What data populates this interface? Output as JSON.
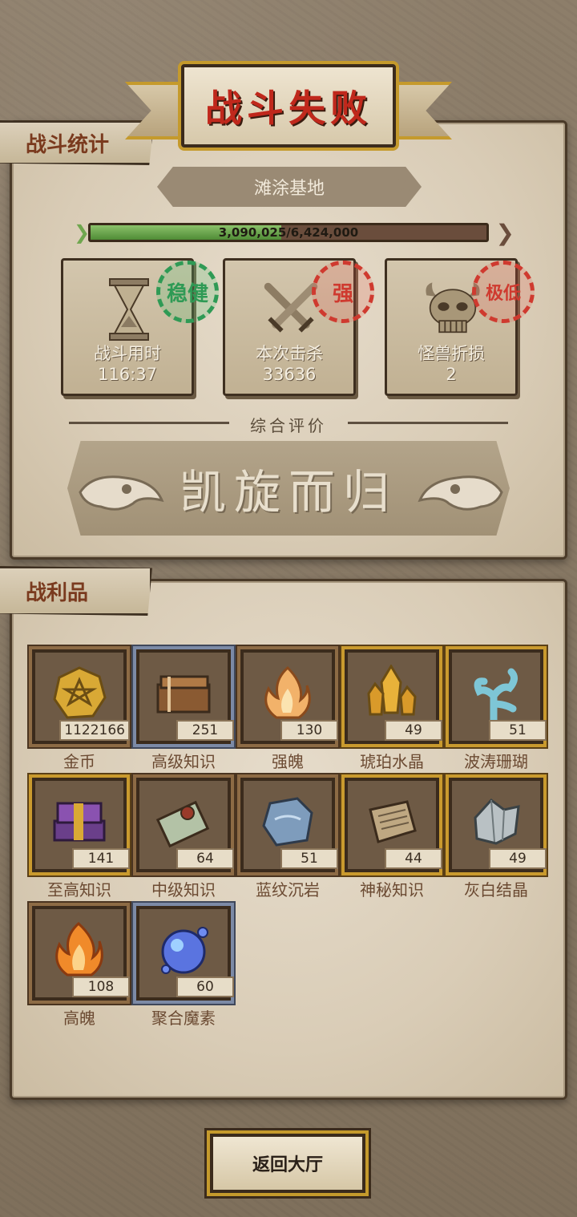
{
  "header": {
    "title": "战斗失败"
  },
  "sections": {
    "stats_label": "战斗统计",
    "loot_label": "战利品"
  },
  "battle": {
    "location": "滩涂基地",
    "progress": {
      "current": 3090025,
      "total": 6424000,
      "text": "3,090,025/6,424,000",
      "fraction": 0.481
    }
  },
  "stats": [
    {
      "label": "战斗用时",
      "value": "116:37",
      "seal": "稳健",
      "seal_color": "#2f9a55",
      "icon": "hourglass-icon"
    },
    {
      "label": "本次击杀",
      "value": "33636",
      "seal": "强",
      "seal_color": "#cf3a2f",
      "icon": "crossed-swords-icon"
    },
    {
      "label": "怪兽折损",
      "value": "2",
      "seal": "极低",
      "seal_color": "#cf3a2f",
      "icon": "monster-skull-icon"
    }
  ],
  "evaluation": {
    "label": "综合评价",
    "result": "凯旋而归"
  },
  "loot": [
    {
      "name": "金币",
      "count": "1122166",
      "tier": "brown",
      "icon": "gold-coin-icon"
    },
    {
      "name": "高级知识",
      "count": "251",
      "tier": "blue",
      "icon": "tome-icon"
    },
    {
      "name": "强魄",
      "count": "130",
      "tier": "brown",
      "icon": "flame-icon"
    },
    {
      "name": "琥珀水晶",
      "count": "49",
      "tier": "gold",
      "icon": "amber-crystal-icon"
    },
    {
      "name": "波涛珊瑚",
      "count": "51",
      "tier": "gold",
      "icon": "coral-icon"
    },
    {
      "name": "至高知识",
      "count": "141",
      "tier": "gold",
      "icon": "purple-book-icon"
    },
    {
      "name": "中级知识",
      "count": "64",
      "tier": "brown",
      "icon": "scroll-icon"
    },
    {
      "name": "蓝纹沉岩",
      "count": "51",
      "tier": "brown",
      "icon": "blue-rock-icon"
    },
    {
      "name": "神秘知识",
      "count": "44",
      "tier": "gold",
      "icon": "stone-tablet-icon"
    },
    {
      "name": "灰白结晶",
      "count": "49",
      "tier": "gold",
      "icon": "grey-crystal-icon"
    },
    {
      "name": "高魄",
      "count": "108",
      "tier": "brown",
      "icon": "orange-flame-icon"
    },
    {
      "name": "聚合魔素",
      "count": "60",
      "tier": "blue",
      "icon": "magic-orb-icon"
    }
  ],
  "footer": {
    "back_label": "返回大厅"
  }
}
